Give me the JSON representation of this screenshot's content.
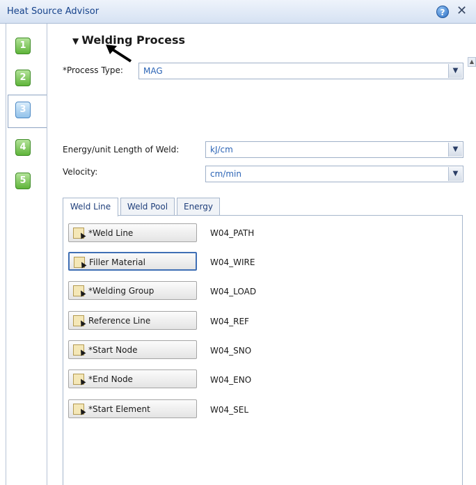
{
  "window": {
    "title": "Heat Source Advisor",
    "help_glyph": "?",
    "close_glyph": "✕"
  },
  "steps": [
    "1",
    "2",
    "3",
    "4",
    "5"
  ],
  "selected_step": "3",
  "section": {
    "title": "Welding Process",
    "expander": "▼"
  },
  "process_type": {
    "label": "*Process Type:",
    "value": "MAG"
  },
  "energy": {
    "label": "Energy/unit Length of Weld:",
    "value": "kJ/cm"
  },
  "velocity": {
    "label": "Velocity:",
    "value": "cm/min"
  },
  "tabs": [
    "Weld Line",
    "Weld Pool",
    "Energy"
  ],
  "active_tab": "Weld Line",
  "pick_rows": [
    {
      "label": "*Weld Line",
      "value": "W04_PATH"
    },
    {
      "label": "Filler Material",
      "value": "W04_WIRE"
    },
    {
      "label": "*Welding Group",
      "value": "W04_LOAD"
    },
    {
      "label": "Reference Line",
      "value": "W04_REF"
    },
    {
      "label": "*Start Node",
      "value": "W04_SNO"
    },
    {
      "label": "*End Node",
      "value": "W04_ENO"
    },
    {
      "label": "*Start Element",
      "value": "W04_SEL"
    }
  ],
  "icons": {
    "help": "help-icon",
    "close": "close-icon",
    "dropdown": "chevron-down-icon",
    "pick": "pick-cursor-icon"
  },
  "colors": {
    "accent": "#15428b",
    "step_green": "#5fb43a",
    "step_selected": "#92c2ea",
    "value_blue": "#2a63b5"
  }
}
